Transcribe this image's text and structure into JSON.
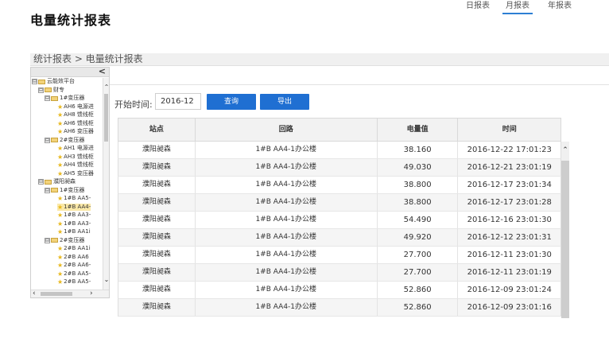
{
  "page_title": "电量统计报表",
  "breadcrumb": "统计报表 > 电量统计报表",
  "tree": {
    "collapse_glyph": "<",
    "items": [
      {
        "level": 0,
        "toggle": "⊟",
        "icon": "folder",
        "label": "云能效平台"
      },
      {
        "level": 1,
        "toggle": "⊟",
        "icon": "folder",
        "label": "财专"
      },
      {
        "level": 2,
        "toggle": "⊟",
        "icon": "folder",
        "label": "1#变压器"
      },
      {
        "level": 3,
        "toggle": "",
        "icon": "star",
        "label": "AH6 电源进"
      },
      {
        "level": 3,
        "toggle": "",
        "icon": "star",
        "label": "AH8 馈线柜"
      },
      {
        "level": 3,
        "toggle": "",
        "icon": "star",
        "label": "AH6 馈线柜"
      },
      {
        "level": 3,
        "toggle": "",
        "icon": "star",
        "label": "AH6 变压器"
      },
      {
        "level": 2,
        "toggle": "⊟",
        "icon": "folder",
        "label": "2#变压器"
      },
      {
        "level": 3,
        "toggle": "",
        "icon": "star",
        "label": "AH1 电源进"
      },
      {
        "level": 3,
        "toggle": "",
        "icon": "star",
        "label": "AH3 馈线柜"
      },
      {
        "level": 3,
        "toggle": "",
        "icon": "star",
        "label": "AH4 馈线柜"
      },
      {
        "level": 3,
        "toggle": "",
        "icon": "star",
        "label": "AH5 变压器"
      },
      {
        "level": 1,
        "toggle": "⊟",
        "icon": "folder",
        "label": "濮阳昶森"
      },
      {
        "level": 2,
        "toggle": "⊟",
        "icon": "folder",
        "label": "1#变压器"
      },
      {
        "level": 3,
        "toggle": "",
        "icon": "star",
        "label": "1#B AA5-"
      },
      {
        "level": 3,
        "toggle": "",
        "icon": "star",
        "label": "1#B AA4-",
        "selected": true
      },
      {
        "level": 3,
        "toggle": "",
        "icon": "star",
        "label": "1#B AA3-"
      },
      {
        "level": 3,
        "toggle": "",
        "icon": "star",
        "label": "1#B AA3-"
      },
      {
        "level": 3,
        "toggle": "",
        "icon": "star",
        "label": "1#B AA1i"
      },
      {
        "level": 2,
        "toggle": "⊟",
        "icon": "folder",
        "label": "2#变压器"
      },
      {
        "level": 3,
        "toggle": "",
        "icon": "star",
        "label": "2#B AA1i"
      },
      {
        "level": 3,
        "toggle": "",
        "icon": "star",
        "label": "2#B AA6"
      },
      {
        "level": 3,
        "toggle": "",
        "icon": "star",
        "label": "2#B AA6-"
      },
      {
        "level": 3,
        "toggle": "",
        "icon": "star",
        "label": "2#B AA5-"
      },
      {
        "level": 3,
        "toggle": "",
        "icon": "star",
        "label": "2#B AA5-"
      }
    ]
  },
  "tabs": [
    {
      "label": "日报表",
      "active": false
    },
    {
      "label": "月报表",
      "active": true
    },
    {
      "label": "年报表",
      "active": false
    }
  ],
  "filter": {
    "start_label": "开始时间:",
    "start_value": "2016-12",
    "query_button": "查询",
    "export_button": "导出"
  },
  "table": {
    "columns": [
      "站点",
      "回路",
      "电量值",
      "时间"
    ],
    "rows": [
      [
        "濮阳昶森",
        "1#B AA4-1办公楼",
        "38.160",
        "2016-12-22 17:01:23"
      ],
      [
        "濮阳昶森",
        "1#B AA4-1办公楼",
        "49.030",
        "2016-12-21 23:01:19"
      ],
      [
        "濮阳昶森",
        "1#B AA4-1办公楼",
        "38.800",
        "2016-12-17 23:01:34"
      ],
      [
        "濮阳昶森",
        "1#B AA4-1办公楼",
        "38.800",
        "2016-12-17 23:01:28"
      ],
      [
        "濮阳昶森",
        "1#B AA4-1办公楼",
        "54.490",
        "2016-12-16 23:01:30"
      ],
      [
        "濮阳昶森",
        "1#B AA4-1办公楼",
        "49.920",
        "2016-12-12 23:01:31"
      ],
      [
        "濮阳昶森",
        "1#B AA4-1办公楼",
        "27.700",
        "2016-12-11 23:01:30"
      ],
      [
        "濮阳昶森",
        "1#B AA4-1办公楼",
        "27.700",
        "2016-12-11 23:01:19"
      ],
      [
        "濮阳昶森",
        "1#B AA4-1办公楼",
        "52.860",
        "2016-12-09 23:01:24"
      ],
      [
        "濮阳昶森",
        "1#B AA4-1办公楼",
        "52.860",
        "2016-12-09 23:01:16"
      ]
    ]
  },
  "colors": {
    "accent": "#1f6fd2",
    "selected_node": "#fbe9a8",
    "star": "#e8b81c"
  }
}
